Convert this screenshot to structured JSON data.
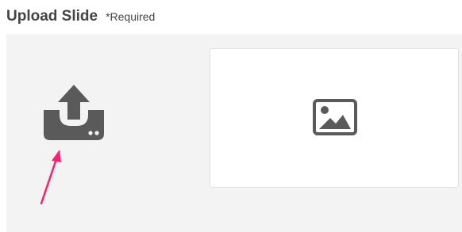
{
  "header": {
    "title": "Upload Slide",
    "required_label": "*Required"
  },
  "icons": {
    "upload": "upload-icon",
    "image_placeholder": "image-icon",
    "annotation_arrow": "arrow-icon"
  },
  "colors": {
    "icon": "#5a5a5a",
    "panel_background": "#f3f3f3",
    "annotation_arrow": "#ff1f6e"
  }
}
